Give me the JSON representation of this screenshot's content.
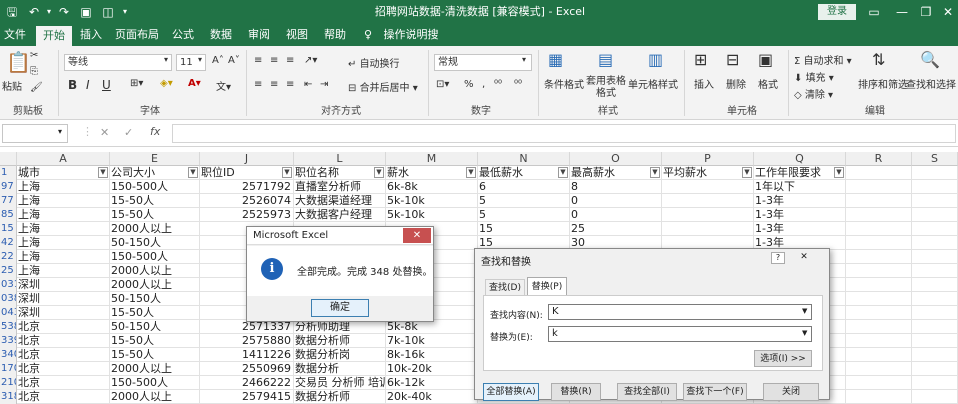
{
  "titlebar": {
    "title": "招聘网站数据-清洗数据 [兼容模式] - Excel",
    "login": "登录",
    "qa_save_icon": "save-icon",
    "minimize": "—",
    "restore": "❐",
    "close": "✕"
  },
  "tabs": [
    "文件",
    "开始",
    "插入",
    "页面布局",
    "公式",
    "数据",
    "审阅",
    "视图",
    "帮助",
    "操作说明搜索"
  ],
  "ribbon": {
    "paste": "粘贴",
    "clipboard": "剪贴板",
    "font_name": "等线",
    "font_size": "11",
    "font_group": "字体",
    "bold": "B",
    "italic": "I",
    "underline": "U",
    "wrap": "自动换行",
    "merge": "合并后居中",
    "align_group": "对齐方式",
    "number_format": "常规",
    "number_group": "数字",
    "cond_format": "条件格式",
    "table_format": "套用表格格式",
    "cell_style": "单元格样式",
    "style_group": "样式",
    "insert": "插入",
    "delete": "删除",
    "format": "格式",
    "cells_group": "单元格",
    "autosum": "自动求和",
    "fill": "填充",
    "clear": "清除",
    "sort_filter": "排序和筛选",
    "find_select": "查找和选择",
    "edit_group": "编辑"
  },
  "formulabar": {
    "cancel": "✕",
    "enter": "✓",
    "fx": "fx",
    "value": ""
  },
  "sheet": {
    "columns": [
      {
        "letter": "A",
        "header": "城市"
      },
      {
        "letter": "E",
        "header": "公司大小"
      },
      {
        "letter": "J",
        "header": "职位ID"
      },
      {
        "letter": "L",
        "header": "职位名称"
      },
      {
        "letter": "M",
        "header": "薪水"
      },
      {
        "letter": "N",
        "header": "最低薪水"
      },
      {
        "letter": "O",
        "header": "最高薪水"
      },
      {
        "letter": "P",
        "header": "平均薪水"
      },
      {
        "letter": "Q",
        "header": "工作年限要求"
      },
      {
        "letter": "R",
        "header": ""
      },
      {
        "letter": "S",
        "header": ""
      }
    ],
    "rows": [
      {
        "n": "1",
        "cells": [
          "城市",
          "公司大小",
          "职位ID",
          "职位名称",
          "薪水",
          "最低薪水",
          "最高薪水",
          "平均薪水",
          "工作年限要求"
        ]
      },
      {
        "n": "97",
        "cells": [
          "上海",
          "150-500人",
          "2571792",
          "直播室分析师",
          "6k-8k",
          "6",
          "8",
          "",
          "1年以下"
        ]
      },
      {
        "n": "77",
        "cells": [
          "上海",
          "15-50人",
          "2526074",
          "大数据渠道经理",
          "5k-10k",
          "5",
          "0",
          "",
          "1-3年"
        ]
      },
      {
        "n": "85",
        "cells": [
          "上海",
          "15-50人",
          "2525973",
          "大数据客户经理",
          "5k-10k",
          "5",
          "0",
          "",
          "1-3年"
        ]
      },
      {
        "n": "15",
        "cells": [
          "上海",
          "2000人以上",
          "",
          "",
          "",
          "15",
          "25",
          "",
          "1-3年"
        ]
      },
      {
        "n": "42",
        "cells": [
          "上海",
          "50-150人",
          "",
          "",
          "",
          "15",
          "30",
          "",
          "1-3年"
        ]
      },
      {
        "n": "22",
        "cells": [
          "上海",
          "150-500人",
          "",
          "",
          "",
          "",
          "",
          "",
          "1-3年"
        ]
      },
      {
        "n": "25",
        "cells": [
          "上海",
          "2000人以上",
          "",
          "",
          "",
          "",
          "",
          "",
          "1-3年"
        ]
      },
      {
        "n": "031",
        "cells": [
          "深圳",
          "2000人以上",
          "",
          "",
          "",
          "",
          "",
          "",
          "1-3年"
        ]
      },
      {
        "n": "038",
        "cells": [
          "深圳",
          "50-150人",
          "",
          "",
          "",
          "",
          "",
          "",
          "1-3年"
        ]
      },
      {
        "n": "043",
        "cells": [
          "深圳",
          "15-50人",
          "",
          "",
          "",
          "",
          "",
          "",
          "1-3年"
        ]
      },
      {
        "n": "538",
        "cells": [
          "北京",
          "50-150人",
          "2571337",
          "分析师助理",
          "5k-8k",
          "",
          "",
          "",
          "1-3年"
        ]
      },
      {
        "n": "339",
        "cells": [
          "北京",
          "15-50人",
          "2575880",
          "数据分析师",
          "7k-10k",
          "",
          "",
          "",
          "1-3年"
        ]
      },
      {
        "n": "340",
        "cells": [
          "北京",
          "15-50人",
          "1411226",
          "数据分析岗",
          "8k-16k",
          "",
          "",
          "",
          "1-3年"
        ]
      },
      {
        "n": "170",
        "cells": [
          "北京",
          "2000人以上",
          "2550969",
          "数据分析",
          "10k-20k",
          "",
          "",
          "",
          "1-3年"
        ]
      },
      {
        "n": "210",
        "cells": [
          "北京",
          "150-500人",
          "2466222",
          "交易员 分析师 培训",
          "6k-12k",
          "",
          "",
          "",
          "1-3年"
        ]
      },
      {
        "n": "318",
        "cells": [
          "北京",
          "2000人以上",
          "2579415",
          "数据分析师",
          "20k-40k",
          "",
          "",
          "",
          "1-3年"
        ]
      }
    ]
  },
  "msgbox": {
    "title": "Microsoft Excel",
    "message": "全部完成。完成 348 处替换。",
    "ok": "确定",
    "info_icon": "i",
    "close": "✕"
  },
  "find_replace": {
    "title": "查找和替换",
    "help": "?",
    "close": "✕",
    "tab_find": "查找(D)",
    "tab_replace": "替换(P)",
    "find_label": "查找内容(N):",
    "find_value": "K",
    "replace_label": "替换为(E):",
    "replace_value": "k",
    "options": "选项(I) >>",
    "replace_all": "全部替换(A)",
    "replace": "替换(R)",
    "find_all": "查找全部(I)",
    "find_next": "查找下一个(F)",
    "close_btn": "关闭"
  }
}
